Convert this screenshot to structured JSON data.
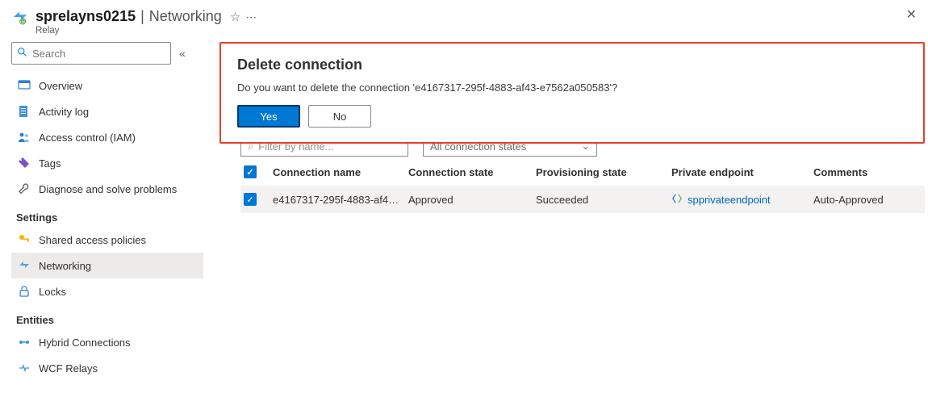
{
  "header": {
    "resource_name": "sprelayns0215",
    "page_name": "Networking",
    "resource_type": "Relay"
  },
  "search": {
    "placeholder": "Search"
  },
  "nav": {
    "items": [
      {
        "label": "Overview"
      },
      {
        "label": "Activity log"
      },
      {
        "label": "Access control (IAM)"
      },
      {
        "label": "Tags"
      },
      {
        "label": "Diagnose and solve problems"
      }
    ],
    "settings_label": "Settings",
    "settings": [
      {
        "label": "Shared access policies"
      },
      {
        "label": "Networking"
      },
      {
        "label": "Locks"
      }
    ],
    "entities_label": "Entities",
    "entities": [
      {
        "label": "Hybrid Connections"
      },
      {
        "label": "WCF Relays"
      }
    ]
  },
  "banner": {
    "title": "Delete connection",
    "message": "Do you want to delete the connection 'e4167317-295f-4883-af43-e7562a050583'?",
    "yes": "Yes",
    "no": "No"
  },
  "filters": {
    "name_placeholder": "Filter by name...",
    "state_selected": "All connection states"
  },
  "table": {
    "headers": {
      "connection_name": "Connection name",
      "connection_state": "Connection state",
      "provisioning_state": "Provisioning state",
      "private_endpoint": "Private endpoint",
      "comments": "Comments"
    },
    "row": {
      "connection_name": "e4167317-295f-4883-af4…",
      "connection_state": "Approved",
      "provisioning_state": "Succeeded",
      "private_endpoint": "spprivateendpoint",
      "comments": "Auto-Approved"
    }
  }
}
